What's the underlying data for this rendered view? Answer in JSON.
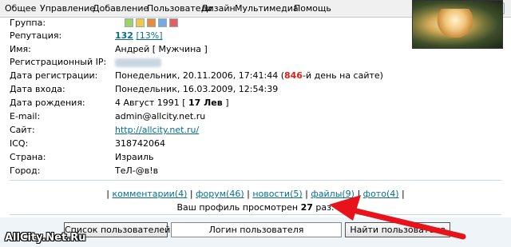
{
  "menu": [
    "Общее",
    "Управление",
    "Добавление",
    "Пользователи",
    "Дизайн",
    "Мультимедиа",
    "Помощь"
  ],
  "profile": {
    "group_label": "Группа:",
    "reputation_label": "Репутация:",
    "reputation_value": "132",
    "reputation_percent": "[13%]",
    "name_label": "Имя:",
    "name_value": "Андрей [ Мужчина ]",
    "ip_label": "Регистрационный IP:",
    "regdate_label": "Дата регистрации:",
    "regdate_value": "Понедельник, 20.11.2006, 17:41:44 (",
    "days_count": "846",
    "days_suffix": "-й день на сайте)",
    "login_label": "Дата входа:",
    "login_value": "Понедельник, 16.03.2009, 12:54:39",
    "birth_label": "Дата рождения:",
    "birth_value_pre": "4 Август 1991 [ ",
    "birth_value_strong": "17 Лев",
    "birth_value_post": " ]",
    "email_label": "E-mail:",
    "email_value": "admin@allcity.net.ru",
    "site_label": "Сайт:",
    "site_value": "http://allcity.net.ru/",
    "icq_label": "ICQ:",
    "icq_value": "318742064",
    "country_label": "Страна:",
    "country_value": "Израиль",
    "city_label": "Город:",
    "city_value": "ТеЛ-@в!в"
  },
  "links": {
    "comments": "комментарии(4)",
    "forum": "форум(46)",
    "news": "новости(5)",
    "files": "файлы(9)",
    "photo": "фото(4)"
  },
  "views": {
    "prefix": "Ваш профиль просмотрен ",
    "count": "27",
    "suffix": " раз."
  },
  "buttons": {
    "user_list": "Список пользователей",
    "login_placeholder": "Логин пользователя",
    "find_user": "Найти пользователя"
  },
  "watermark": "AllCity.Net.Ru",
  "colors": {
    "link": "#0b6d8c",
    "accent_red": "#d9231b",
    "arrow": "#e8121b"
  }
}
